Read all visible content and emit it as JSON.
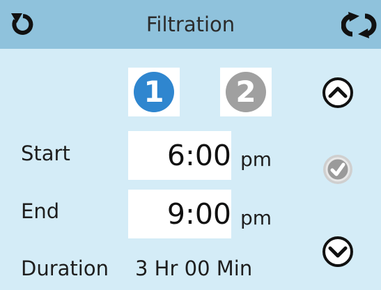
{
  "header": {
    "title": "Filtration",
    "left_icon": "back-arrow-icon",
    "right_icon": "refresh-sync-icon",
    "bg_color": "#8fc2dc"
  },
  "filter_tabs": [
    {
      "label": "1",
      "selected": true,
      "color": "#2f86cf"
    },
    {
      "label": "2",
      "selected": false,
      "color": "#a0a0a0"
    }
  ],
  "rows": {
    "start": {
      "label": "Start",
      "time": "6:00",
      "period": "pm"
    },
    "end": {
      "label": "End",
      "time": "9:00",
      "period": "pm"
    },
    "duration": {
      "label": "Duration",
      "value": "3 Hr 00 Min"
    }
  },
  "side_buttons": {
    "up": "chevron-up-icon",
    "confirm": "checkmark-icon",
    "down": "chevron-down-icon"
  },
  "colors": {
    "background": "#d4ecf7",
    "field": "#ffffff"
  }
}
